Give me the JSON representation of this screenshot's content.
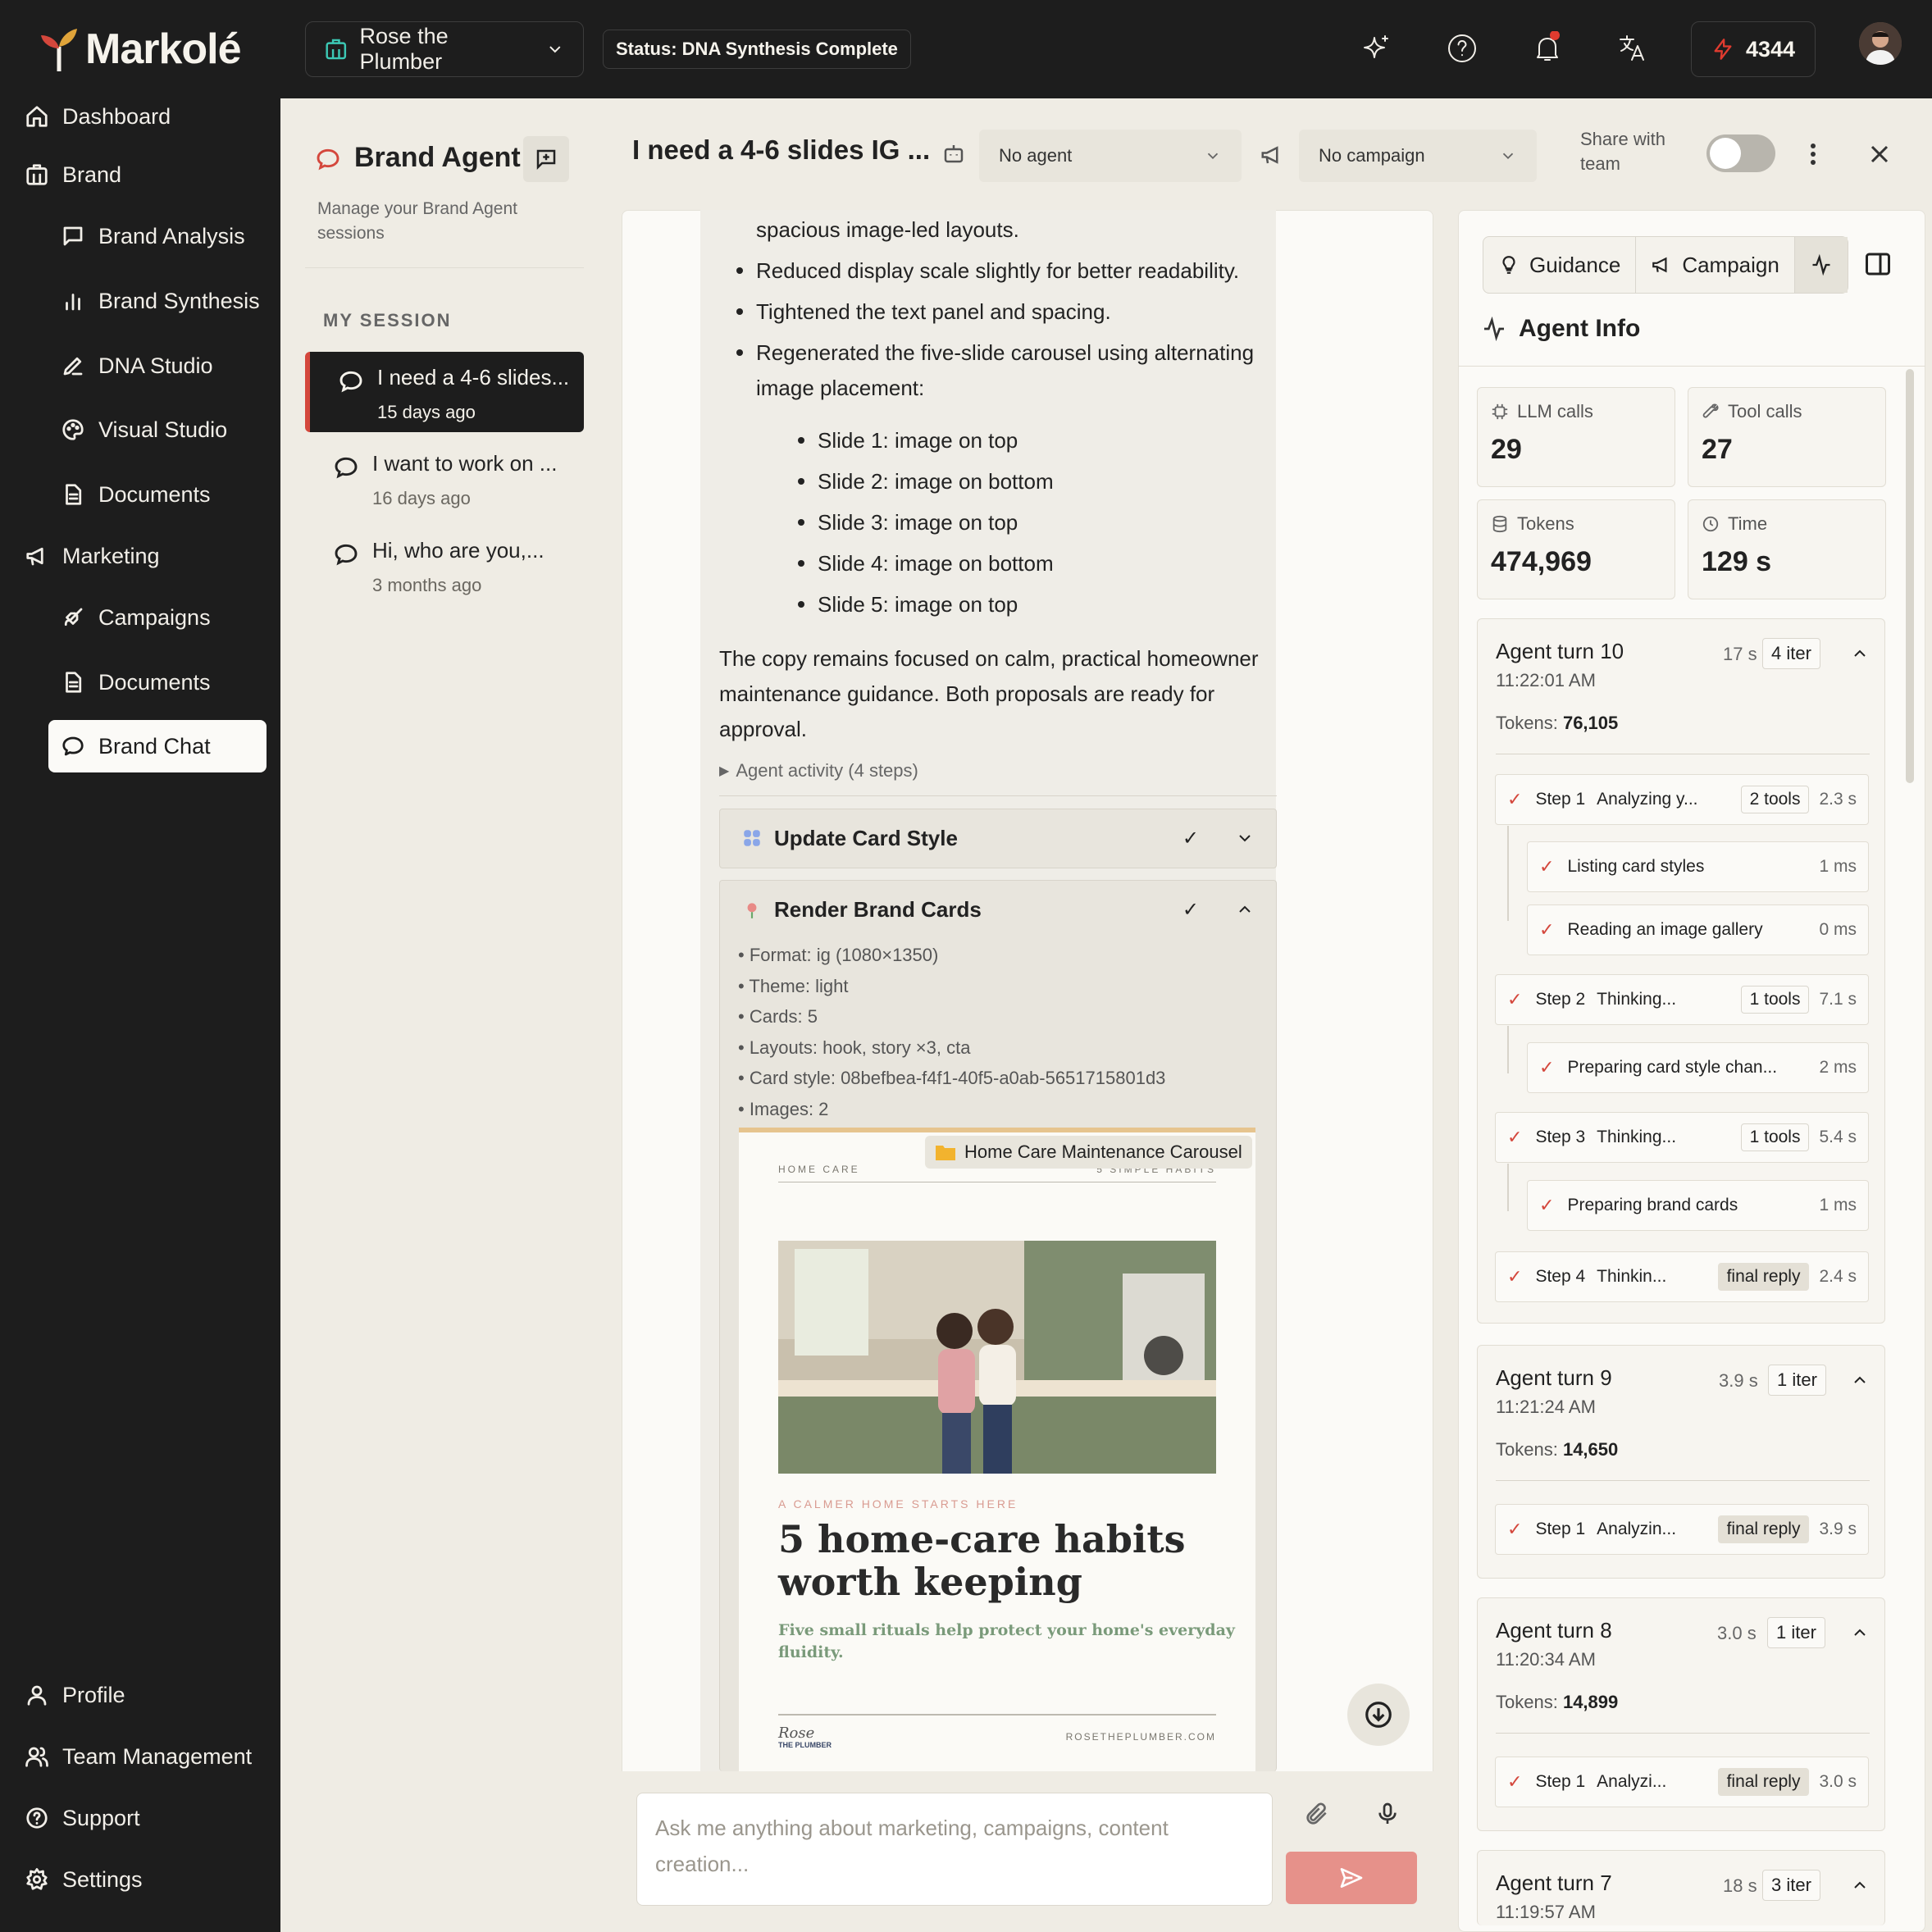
{
  "app": {
    "logo_text": "Markolé"
  },
  "sidebar": {
    "items": [
      {
        "label": "Dashboard"
      },
      {
        "label": "Brand"
      },
      {
        "label": "Brand Analysis"
      },
      {
        "label": "Brand Synthesis"
      },
      {
        "label": "DNA Studio"
      },
      {
        "label": "Visual Studio"
      },
      {
        "label": "Documents"
      },
      {
        "label": "Marketing"
      },
      {
        "label": "Campaigns"
      },
      {
        "label": "Documents"
      },
      {
        "label": "Brand Chat"
      }
    ],
    "bottom": [
      {
        "label": "Profile"
      },
      {
        "label": "Team Management"
      },
      {
        "label": "Support"
      },
      {
        "label": "Settings"
      }
    ]
  },
  "topbar": {
    "brand": "Rose the Plumber",
    "status": "Status: DNA Synthesis Complete",
    "credits": "4344"
  },
  "sessions": {
    "title": "Brand Agent",
    "subtitle": "Manage your Brand Agent sessions",
    "section": "MY SESSION",
    "items": [
      {
        "title": "I need a 4-6 slides...",
        "date": "15 days ago"
      },
      {
        "title": "I want to work on ...",
        "date": "16 days ago"
      },
      {
        "title": "Hi, who are you,...",
        "date": "3 months ago"
      }
    ]
  },
  "chat_header": {
    "title": "I need a 4-6 slides IG ...",
    "agent": "No agent",
    "campaign": "No campaign",
    "share": "Share with team"
  },
  "message": {
    "partial": "spacious image-led layouts.",
    "bullets": [
      "Reduced display scale slightly for better readability.",
      "Tightened the text panel and spacing.",
      "Regenerated the five-slide carousel using alternating",
      "image placement:"
    ],
    "slides": [
      "Slide 1: image on top",
      "Slide 2: image on bottom",
      "Slide 3: image on top",
      "Slide 4: image on bottom",
      "Slide 5: image on top"
    ],
    "para1": "The copy remains focused on calm, practical homeowner",
    "para2": "maintenance guidance. Both proposals are ready for",
    "para3": "approval.",
    "activity": "Agent activity (4 steps)"
  },
  "tools": {
    "update": "Update Card Style",
    "render": "Render Brand Cards",
    "details": [
      "• Format: ig (1080×1350)",
      "• Theme: light",
      "• Cards: 5",
      "• Layouts: hook, story ×3, cta",
      "• Card style: 08befbea-f4f1-40f5-a0ab-5651715801d3",
      "• Images: 2"
    ]
  },
  "preview": {
    "folder": "Home Care Maintenance Carousel",
    "kicker_left": "HOME CARE",
    "kicker_right": "5 SIMPLE HABITS",
    "eyebrow": "A CALMER HOME STARTS HERE",
    "headline1": "5 home-care habits",
    "headline2": "worth keeping",
    "sub1": "Five small rituals help protect your home's everyday",
    "sub2": "fluidity.",
    "sig1": "Rose",
    "sig2": "THE PLUMBER",
    "site": "ROSETHEPLUMBER.COM"
  },
  "input": {
    "placeholder1": "Ask me anything about marketing, campaigns, content",
    "placeholder2": "creation..."
  },
  "right": {
    "tabs": {
      "guidance": "Guidance",
      "campaign": "Campaign"
    },
    "title": "Agent Info",
    "stats": {
      "llm_label": "LLM calls",
      "llm": "29",
      "tool_label": "Tool calls",
      "tool": "27",
      "tokens_label": "Tokens",
      "tokens": "474,969",
      "time_label": "Time",
      "time": "129 s"
    },
    "turns": [
      {
        "title": "Agent turn 10",
        "time": "11:22:01 AM",
        "dur": "17 s",
        "iter": "4 iter",
        "tokens_label": "Tokens:",
        "tokens": "76,105"
      },
      {
        "title": "Agent turn 9",
        "time": "11:21:24 AM",
        "dur": "3.9 s",
        "iter": "1 iter",
        "tokens_label": "Tokens:",
        "tokens": "14,650"
      },
      {
        "title": "Agent turn 8",
        "time": "11:20:34 AM",
        "dur": "3.0 s",
        "iter": "1 iter",
        "tokens_label": "Tokens:",
        "tokens": "14,899"
      },
      {
        "title": "Agent turn 7",
        "time": "11:19:57 AM",
        "dur": "18 s",
        "iter": "3 iter"
      }
    ],
    "steps10": [
      {
        "label": "Step 1",
        "name": "Analyzing y...",
        "tool": "2 tools",
        "dur": "2.3 s"
      },
      {
        "label": "",
        "name": "Listing card styles",
        "tool": "",
        "dur": "1 ms"
      },
      {
        "label": "",
        "name": "Reading an image gallery",
        "tool": "",
        "dur": "0 ms"
      },
      {
        "label": "Step 2",
        "name": "Thinking...",
        "tool": "1 tools",
        "dur": "7.1 s"
      },
      {
        "label": "",
        "name": "Preparing card style chan...",
        "tool": "",
        "dur": "2 ms"
      },
      {
        "label": "Step 3",
        "name": "Thinking...",
        "tool": "1 tools",
        "dur": "5.4 s"
      },
      {
        "label": "",
        "name": "Preparing brand cards",
        "tool": "",
        "dur": "1 ms"
      },
      {
        "label": "Step 4",
        "name": "Thinkin...",
        "tool": "final reply",
        "dur": "2.4 s"
      }
    ],
    "step9": {
      "label": "Step 1",
      "name": "Analyzin...",
      "tool": "final reply",
      "dur": "3.9 s"
    },
    "step8": {
      "label": "Step 1",
      "name": "Analyzi...",
      "tool": "final reply",
      "dur": "3.0 s"
    }
  }
}
